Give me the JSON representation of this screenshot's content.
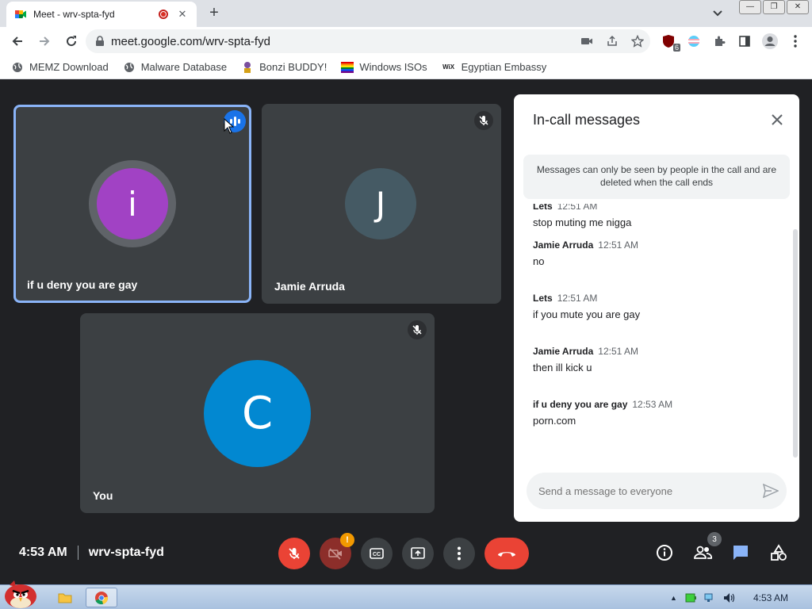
{
  "browser": {
    "tab_title": "Meet - wrv-spta-fyd",
    "url": "meet.google.com/wrv-spta-fyd",
    "extension_badge": "6",
    "bookmarks": [
      {
        "label": "MEMZ Download",
        "icon": "globe-icon"
      },
      {
        "label": "Malware Database",
        "icon": "globe-icon"
      },
      {
        "label": "Bonzi BUDDY!",
        "icon": "bonzi-icon"
      },
      {
        "label": "Windows ISOs",
        "icon": "rainbow-flag-icon"
      },
      {
        "label": "Egyptian Embassy",
        "icon": "wix-icon"
      }
    ],
    "wix_glyph": "WiX"
  },
  "meet": {
    "tiles": [
      {
        "name": "if u deny you are gay",
        "initial": "i",
        "color": "#a142c4",
        "speaking": true
      },
      {
        "name": "Jamie Arruda",
        "initial": "J",
        "color": "#455a64",
        "muted": true
      },
      {
        "name": "You",
        "initial": "C",
        "color": "#0288d1",
        "muted": true
      }
    ],
    "chat": {
      "title": "In-call messages",
      "notice": "Messages can only be seen by people in the call and are deleted when the call ends",
      "partial_sender": "Lets",
      "partial_time": "12:51 AM",
      "partial_text": "stop muting me nigga",
      "messages": [
        {
          "sender": "Jamie Arruda",
          "time": "12:51 AM",
          "text": "no"
        },
        {
          "sender": "Lets",
          "time": "12:51 AM",
          "text": "if you mute you are gay"
        },
        {
          "sender": "Jamie Arruda",
          "time": "12:51 AM",
          "text": "then ill kick u"
        },
        {
          "sender": "if u deny you are gay",
          "time": "12:53 AM",
          "text": "porn.com"
        }
      ],
      "input_placeholder": "Send a message to everyone"
    },
    "bottom": {
      "time": "4:53 AM",
      "meeting_code": "wrv-spta-fyd",
      "camera_warning": "!",
      "people_count": "3"
    }
  },
  "taskbar": {
    "clock": "4:53 AM"
  }
}
